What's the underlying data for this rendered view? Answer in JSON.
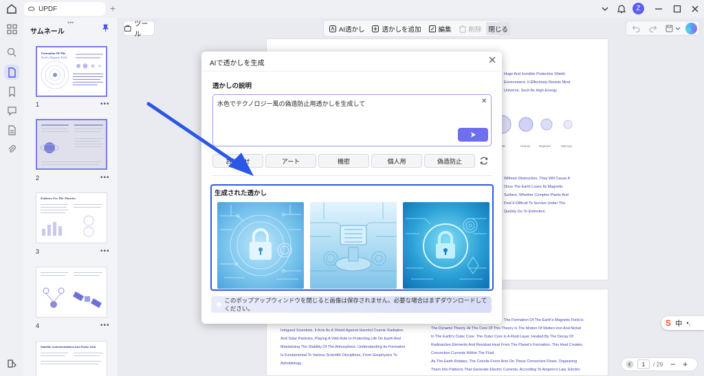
{
  "app": {
    "tab_title": "UPDF",
    "avatar_letter": "Z"
  },
  "thumbs": {
    "title": "サムネール",
    "pages": [
      "1",
      "2",
      "3",
      "4"
    ],
    "page1_title_line1": "Formation Of The",
    "page1_title_line2": "Earth's Magnetic Field",
    "page3_title": "Evidence For The Theories",
    "page5_title": "Satellite Communications And Power Grid",
    "more": "•••"
  },
  "toolbar": {
    "tools_label": "ツール",
    "ai_watermark": "AI透かし",
    "add_watermark": "透かしを追加",
    "edit": "編集",
    "delete": "削除",
    "close": "閉じる"
  },
  "pager": {
    "current": "1",
    "total": "/ 29"
  },
  "lang": {
    "label": "中"
  },
  "dialog": {
    "title": "AIで透かしを生成",
    "prompt_label": "透かしの説明",
    "prompt_value": "水色でテクノロジー風の偽造防止用透かしを生成して",
    "presets": [
      "お知らせ",
      "アート",
      "機密",
      "個人用",
      "偽造防止"
    ],
    "generated_label": "生成された透かし",
    "notice": "このポップアップウィンドウを閉じると画像は保存されません。必要な場合はまずダウンロードしてください。"
  },
  "doc": {
    "page1_right_lines": [
      "Huge And Invisible Protective Shield,",
      "Environment. It Effectively Resists Most",
      "Universe, Such As High-Energy"
    ],
    "planet_labels": [
      "Uranus",
      "Neptune",
      "Mercury"
    ],
    "page1_mid_lines": [
      "Without Obstruction, They Will Cause A",
      "Once The Earth Loses Its Magnetic",
      "Surface, Whether Complex Plants And",
      "Find It Difficult To Survive Under The",
      "Quickly Go To Extinction."
    ],
    "page2_left_lines": [
      "Intrigued Scientists. It Acts As A Shield Against Harmful Cosmic Radiation",
      "And Solar Particles, Playing A Vital Role In Protecting Life On Earth And",
      "Maintaining The Stability Of The Atmosphere. Understanding Its Formation",
      "Is Fundamental To Various Scientific Disciplines, From Geophysics To",
      "Astrobiology."
    ],
    "page2_right_lines": [
      "The Formation Of The Earth's Magnetic Field Is",
      "The Dynamo Theory. At The Core Of This Theory Is The Motion Of Molten Iron And Nickel",
      "In The Earth's Outer Core. The Outer Core Is A Fluid Layer, Heated By The Decay Of",
      "Radioactive Elements And Residual Heat From The Planet's Formation. This Heat Creates",
      "Convection Currents Within The Fluid.",
      "As The Earth Rotates, The Coriolis Force Acts On These Convective Flows, Organizing",
      "Them Into Patterns That Generate Electric Currents. According To Ampere's Law, Electric"
    ]
  },
  "colors": {
    "accent": "#6d6ff0",
    "highlight": "#2b57e6",
    "doc_text": "#3c3fb3"
  }
}
